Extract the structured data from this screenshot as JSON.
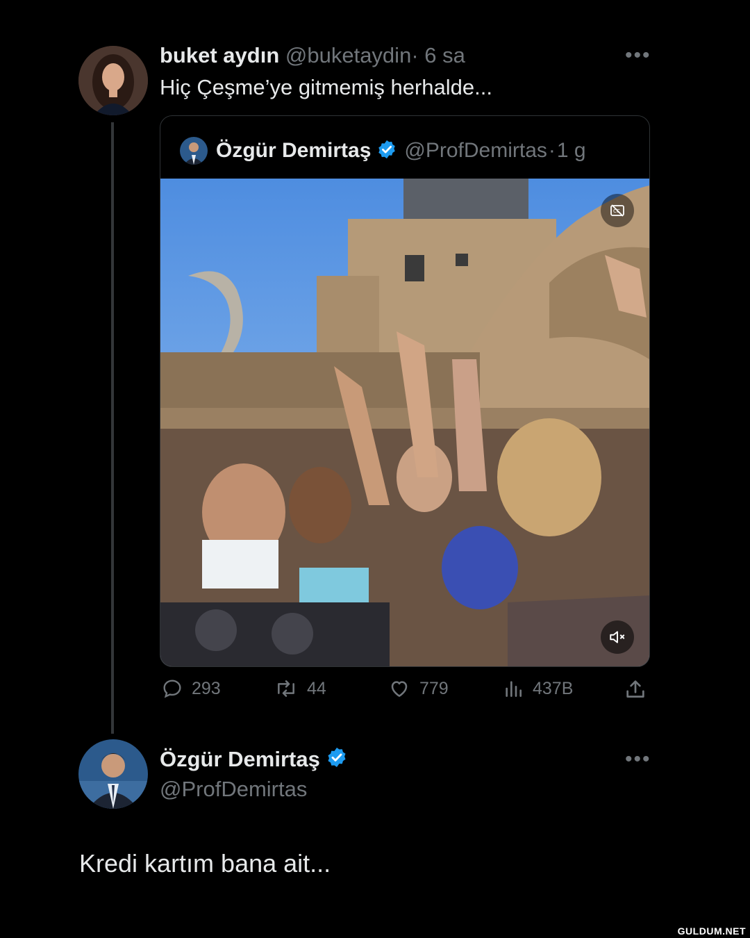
{
  "original_tweet": {
    "display_name": "buket aydın",
    "handle": "@buketaydin",
    "separator": "·",
    "time": "6 sa",
    "text": "Hiç Çeşme’ye gitmemiş herhalde...",
    "avatar_icon": "woman-portrait-avatar"
  },
  "quoted_tweet": {
    "display_name": "Özgür Demirtaş",
    "handle": "@ProfDemirtas",
    "separator": "·",
    "time": "1 g",
    "verified": true,
    "media_description_icons": [
      "captions-icon",
      "mute-icon"
    ]
  },
  "actions": {
    "replies": "293",
    "retweets": "44",
    "likes": "779",
    "views": "437B"
  },
  "reply_tweet": {
    "display_name": "Özgür Demirtaş",
    "handle": "@ProfDemirtas",
    "verified": true,
    "text": "Kredi kartım bana ait..."
  },
  "watermark": "GULDUM.NET",
  "colors": {
    "background": "#000000",
    "text": "#e7e9ea",
    "muted": "#71767b",
    "verified_blue": "#1d9bf0",
    "border": "#2f3336"
  }
}
